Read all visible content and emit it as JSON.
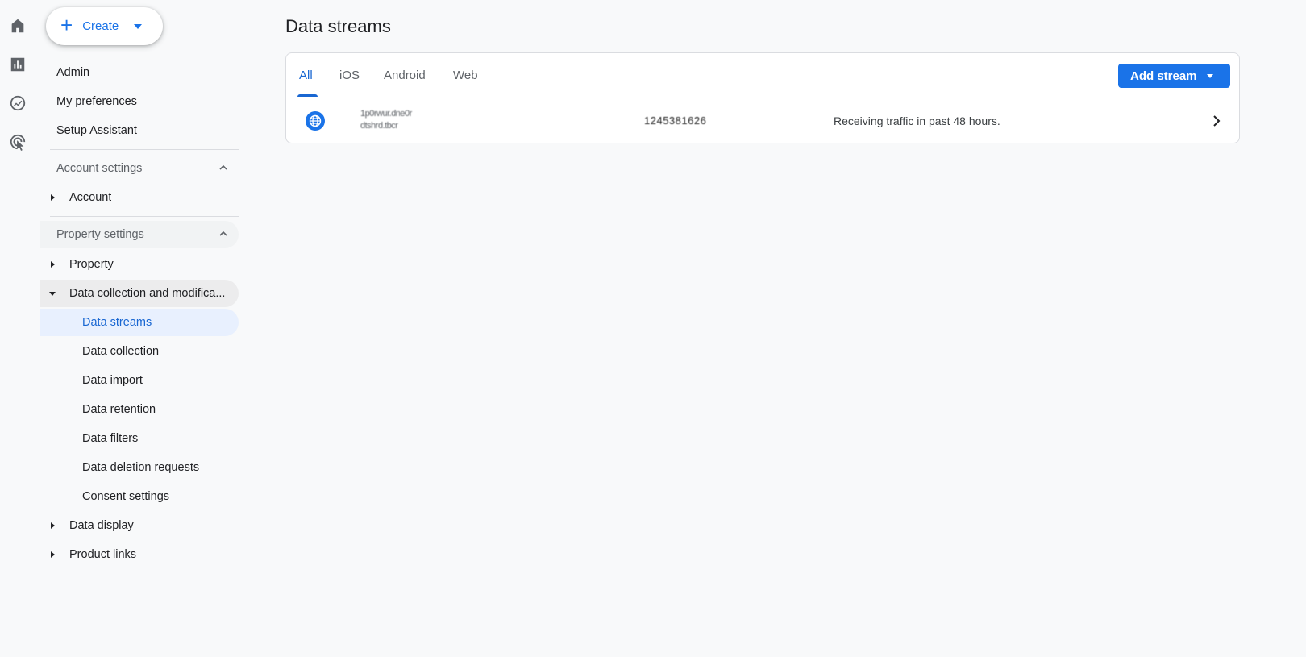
{
  "rail": {
    "icons": [
      "home-icon",
      "reports-icon",
      "explore-icon",
      "advertising-icon"
    ]
  },
  "create": {
    "label": "Create"
  },
  "top_nav": [
    {
      "label": "Admin"
    },
    {
      "label": "My preferences"
    },
    {
      "label": "Setup Assistant"
    }
  ],
  "account_settings": {
    "title": "Account settings",
    "items": [
      {
        "label": "Account"
      }
    ]
  },
  "property_settings": {
    "title": "Property settings",
    "items": [
      {
        "label": "Property"
      },
      {
        "label": "Data collection and modifica..."
      }
    ],
    "sub_items": [
      {
        "label": "Data streams"
      },
      {
        "label": "Data collection"
      },
      {
        "label": "Data import"
      },
      {
        "label": "Data retention"
      },
      {
        "label": "Data filters"
      },
      {
        "label": "Data deletion requests"
      },
      {
        "label": "Consent settings"
      }
    ],
    "after_items": [
      {
        "label": "Data display"
      },
      {
        "label": "Product links"
      }
    ]
  },
  "main": {
    "title": "Data streams",
    "tabs": [
      {
        "label": "All"
      },
      {
        "label": "iOS"
      },
      {
        "label": "Android"
      },
      {
        "label": "Web"
      }
    ],
    "add_stream_label": "Add stream",
    "streams": [
      {
        "name_line1": "1p0rwur.dne0r",
        "name_line2": "dtshrd.tbcr",
        "stream_id": "1245381626",
        "status": "Receiving traffic in past 48 hours."
      }
    ]
  },
  "colors": {
    "accent": "#1a73e8",
    "active_nav_bg": "#e8f0fe",
    "active_text": "#1967d2"
  }
}
